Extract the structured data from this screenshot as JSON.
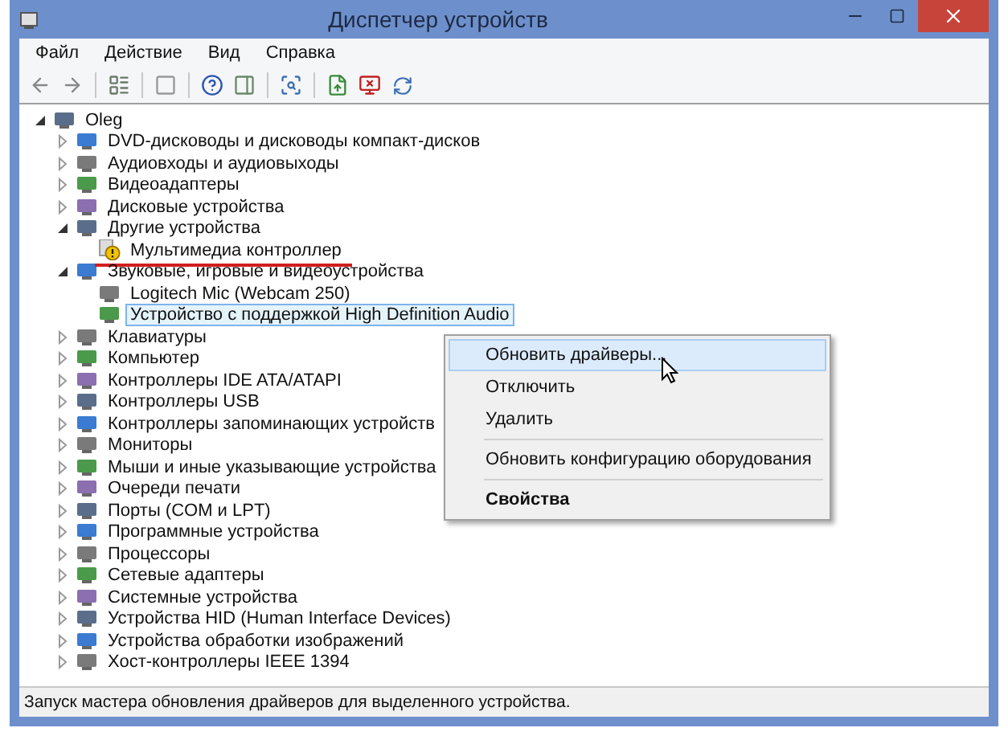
{
  "window": {
    "title": "Диспетчер устройств"
  },
  "menu": [
    "Файл",
    "Действие",
    "Вид",
    "Справка"
  ],
  "tree": {
    "label": "Oleg",
    "expanded": true,
    "selected": false,
    "children": [
      {
        "label": "DVD-дисководы и дисководы компакт-дисков",
        "expanded": false,
        "selected": false
      },
      {
        "label": "Аудиовходы и аудиовыходы",
        "expanded": false,
        "selected": false
      },
      {
        "label": "Видеоадаптеры",
        "expanded": false,
        "selected": false
      },
      {
        "label": "Дисковые устройства",
        "expanded": false,
        "selected": false
      },
      {
        "label": "Другие устройства",
        "expanded": true,
        "selected": false,
        "children": [
          {
            "label": "Мультимедиа контроллер",
            "selected": false,
            "warning": true,
            "marked": true
          }
        ]
      },
      {
        "label": "Звуковые, игровые и видеоустройства",
        "expanded": true,
        "selected": false,
        "children": [
          {
            "label": "Logitech Mic (Webcam 250)",
            "selected": false
          },
          {
            "label": "Устройство с поддержкой High Definition Audio",
            "selected": true
          }
        ]
      },
      {
        "label": "Клавиатуры",
        "expanded": false,
        "selected": false
      },
      {
        "label": "Компьютер",
        "expanded": false,
        "selected": false
      },
      {
        "label": "Контроллеры IDE ATA/ATAPI",
        "expanded": false,
        "selected": false
      },
      {
        "label": "Контроллеры USB",
        "expanded": false,
        "selected": false
      },
      {
        "label": "Контроллеры запоминающих устройств",
        "expanded": false,
        "selected": false
      },
      {
        "label": "Мониторы",
        "expanded": false,
        "selected": false
      },
      {
        "label": "Мыши и иные указывающие устройства",
        "expanded": false,
        "selected": false
      },
      {
        "label": "Очереди печати",
        "expanded": false,
        "selected": false
      },
      {
        "label": "Порты (COM и LPT)",
        "expanded": false,
        "selected": false
      },
      {
        "label": "Программные устройства",
        "expanded": false,
        "selected": false
      },
      {
        "label": "Процессоры",
        "expanded": false,
        "selected": false
      },
      {
        "label": "Сетевые адаптеры",
        "expanded": false,
        "selected": false
      },
      {
        "label": "Системные устройства",
        "expanded": false,
        "selected": false
      },
      {
        "label": "Устройства HID (Human Interface Devices)",
        "expanded": false,
        "selected": false
      },
      {
        "label": "Устройства обработки изображений",
        "expanded": false,
        "selected": false
      },
      {
        "label": "Хост-контроллеры IEEE 1394",
        "expanded": false,
        "selected": false
      }
    ]
  },
  "context_menu": [
    {
      "kind": "item",
      "label": "Обновить драйверы...",
      "selected": true,
      "default": false
    },
    {
      "kind": "item",
      "label": "Отключить",
      "selected": false,
      "default": false
    },
    {
      "kind": "item",
      "label": "Удалить",
      "selected": false,
      "default": false
    },
    {
      "kind": "separator"
    },
    {
      "kind": "item",
      "label": "Обновить конфигурацию оборудования",
      "selected": false,
      "default": false
    },
    {
      "kind": "separator"
    },
    {
      "kind": "item",
      "label": "Свойства",
      "selected": false,
      "default": true
    }
  ],
  "status_bar": "Запуск мастера обновления драйверов для выделенного устройства."
}
